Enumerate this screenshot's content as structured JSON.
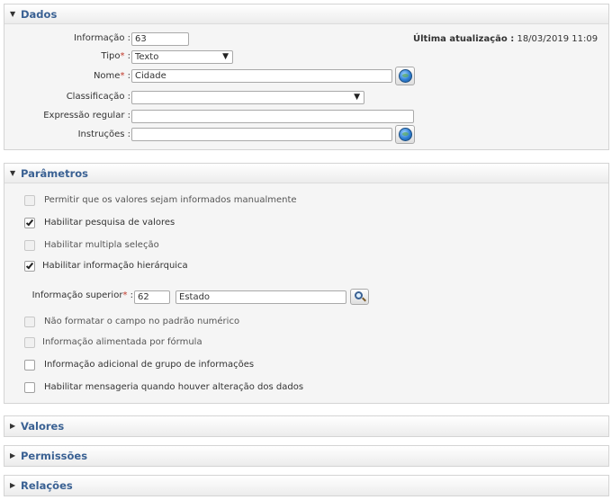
{
  "dados": {
    "title": "Dados",
    "informacao_label": "Informação :",
    "informacao_value": "63",
    "tipo_label": "Tipo",
    "tipo_value": "Texto",
    "nome_label": "Nome",
    "nome_value": "Cidade",
    "classificacao_label": "Classificação :",
    "classificacao_value": "",
    "expressao_label": "Expressão regular :",
    "expressao_value": "",
    "instrucoes_label": "Instruções :",
    "instrucoes_value": "",
    "ultima_label": "Última atualização :",
    "ultima_value": "18/03/2019 11:09",
    "required_mark": "*",
    "colon": ":"
  },
  "parametros": {
    "title": "Parâmetros",
    "options": [
      {
        "label": "Permitir que os valores sejam informados manualmente",
        "checked": false,
        "disabled": true
      },
      {
        "label": "Habilitar pesquisa de valores",
        "checked": true,
        "disabled": false
      },
      {
        "label": "Habilitar multipla seleção",
        "checked": false,
        "disabled": true
      },
      {
        "label": "Habilitar informação hierárquica",
        "checked": true,
        "disabled": false
      },
      {
        "label": "Não formatar o campo no padrão numérico",
        "checked": false,
        "disabled": true
      },
      {
        "label": "Informação alimentada por fórmula",
        "checked": false,
        "disabled": true
      },
      {
        "label": "Informação adicional de grupo de informações",
        "checked": false,
        "disabled": false
      },
      {
        "label": "Habilitar mensageria quando houver alteração dos dados",
        "checked": false,
        "disabled": false
      }
    ],
    "superior_label": "Informação superior",
    "superior_code": "62",
    "superior_name": "Estado"
  },
  "sections": {
    "valores": "Valores",
    "permissoes": "Permissões",
    "relacoes": "Relações"
  },
  "colors": {
    "header_text": "#3a6193",
    "required": "#c0392b",
    "body_bg": "#f5f5f5"
  }
}
